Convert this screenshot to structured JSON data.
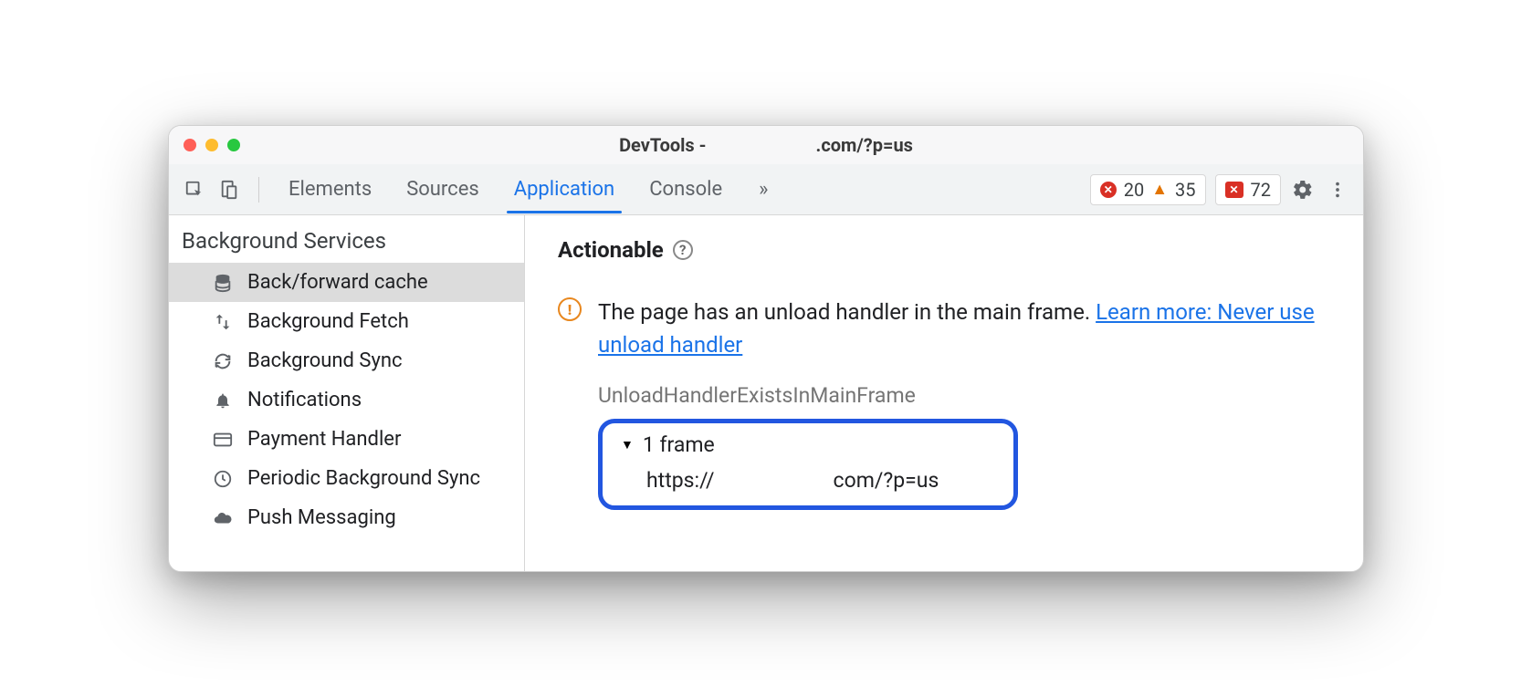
{
  "window": {
    "title_prefix": "DevTools - ",
    "title_suffix": ".com/?p=us"
  },
  "tabs": {
    "items": [
      "Elements",
      "Sources",
      "Application",
      "Console"
    ],
    "active_index": 2,
    "overflow_glyph": "»"
  },
  "counters": {
    "errors": "20",
    "warnings": "35",
    "issues": "72"
  },
  "sidebar": {
    "heading": "Background Services",
    "items": [
      {
        "label": "Back/forward cache",
        "icon": "database",
        "selected": true
      },
      {
        "label": "Background Fetch",
        "icon": "updown",
        "selected": false
      },
      {
        "label": "Background Sync",
        "icon": "sync",
        "selected": false
      },
      {
        "label": "Notifications",
        "icon": "bell",
        "selected": false
      },
      {
        "label": "Payment Handler",
        "icon": "card",
        "selected": false
      },
      {
        "label": "Periodic Background Sync",
        "icon": "clock",
        "selected": false
      },
      {
        "label": "Push Messaging",
        "icon": "cloud",
        "selected": false
      }
    ]
  },
  "content": {
    "section_title": "Actionable",
    "help_glyph": "?",
    "warning_glyph": "!",
    "message_plain": "The page has an unload handler in the main frame. ",
    "message_link": "Learn more: Never use unload handler",
    "reason_label": "UnloadHandlerExistsInMainFrame",
    "frame": {
      "count_label": "1 frame",
      "url_prefix": "https://",
      "url_suffix": "com/?p=us"
    }
  }
}
